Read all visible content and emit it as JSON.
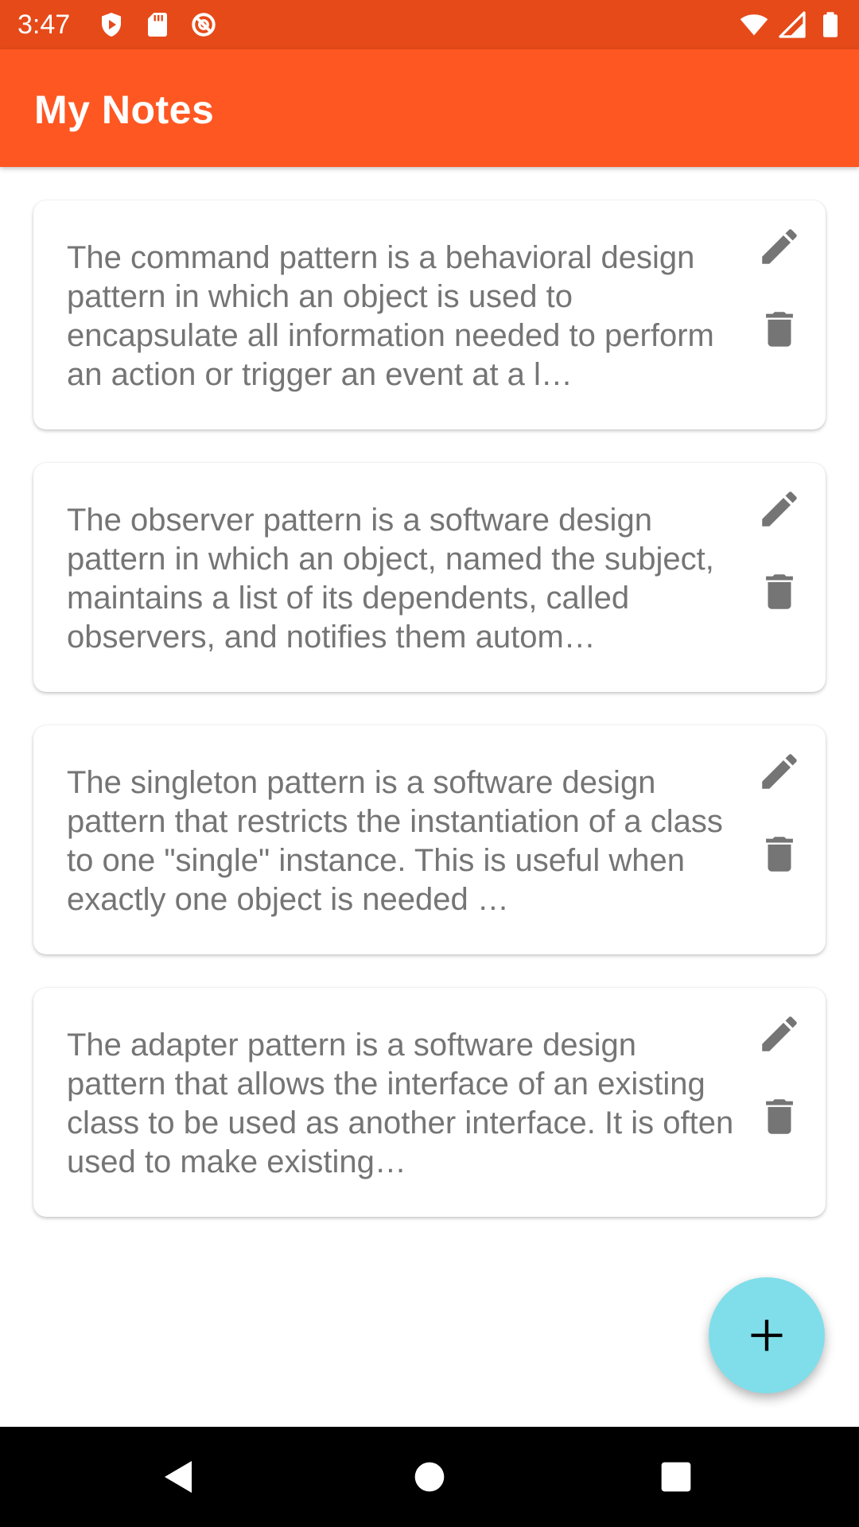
{
  "status_bar": {
    "time": "3:47",
    "left_icons": [
      "shield-play-icon",
      "sd-card-icon",
      "no-sync-icon"
    ],
    "right_icons": [
      "wifi-icon",
      "signal-icon",
      "battery-icon"
    ]
  },
  "app_bar": {
    "title": "My Notes"
  },
  "notes": [
    {
      "text": "The command pattern is a behavioral design pattern in which an object is used to encapsulate all information needed to perform an action or trigger an event at a l…"
    },
    {
      "text": "The observer pattern is a software design pattern in which an object, named the subject, maintains a list of its dependents, called observers, and notifies them autom…"
    },
    {
      "text": "The singleton pattern is a software design pattern that restricts the instantiation of a class to one \"single\" instance. This is useful when exactly one object is needed …"
    },
    {
      "text": "The adapter pattern is a software design pattern that allows the interface of an existing class to be used as another interface. It is often used to make existing…"
    }
  ],
  "note_actions": {
    "edit_icon": "pencil-icon",
    "delete_icon": "trash-icon"
  },
  "fab": {
    "icon": "plus-icon"
  },
  "nav_bar": {
    "buttons": [
      "back-icon",
      "home-icon",
      "recents-icon"
    ]
  },
  "colors": {
    "status_bar": "#e64a19",
    "app_bar": "#ff5722",
    "fab": "#80deea",
    "note_text": "#757575",
    "icon": "#757575"
  }
}
